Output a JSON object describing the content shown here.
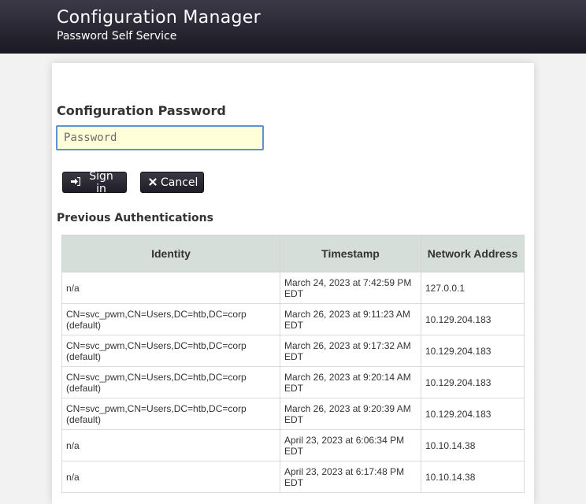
{
  "header": {
    "title": "Configuration Manager",
    "subtitle": "Password Self Service"
  },
  "login": {
    "heading": "Configuration Password",
    "password_placeholder": "Password",
    "signin_label": "Sign in",
    "cancel_label": "Cancel"
  },
  "auth_table": {
    "heading": "Previous Authentications",
    "columns": [
      "Identity",
      "Timestamp",
      "Network Address"
    ],
    "rows": [
      {
        "identity": "n/a",
        "timestamp": "March 24, 2023 at 7:42:59 PM EDT",
        "address": "127.0.0.1"
      },
      {
        "identity": "CN=svc_pwm,CN=Users,DC=htb,DC=corp (default)",
        "timestamp": "March 26, 2023 at 9:11:23 AM EDT",
        "address": "10.129.204.183"
      },
      {
        "identity": "CN=svc_pwm,CN=Users,DC=htb,DC=corp (default)",
        "timestamp": "March 26, 2023 at 9:17:32 AM EDT",
        "address": "10.129.204.183"
      },
      {
        "identity": "CN=svc_pwm,CN=Users,DC=htb,DC=corp (default)",
        "timestamp": "March 26, 2023 at 9:20:14 AM EDT",
        "address": "10.129.204.183"
      },
      {
        "identity": "CN=svc_pwm,CN=Users,DC=htb,DC=corp (default)",
        "timestamp": "March 26, 2023 at 9:20:39 AM EDT",
        "address": "10.129.204.183"
      },
      {
        "identity": "n/a",
        "timestamp": "April 23, 2023 at 6:06:34 PM EDT",
        "address": "10.10.14.38"
      },
      {
        "identity": "n/a",
        "timestamp": "April 23, 2023 at 6:17:48 PM EDT",
        "address": "10.10.14.38"
      }
    ]
  },
  "icons": {
    "signin": "sign-in-icon",
    "cancel": "close-icon"
  },
  "colors": {
    "header_bg": "#1a1822",
    "input_bg": "#ffffd8",
    "input_border": "#5b93d4",
    "table_header_bg": "#d6ded9"
  }
}
